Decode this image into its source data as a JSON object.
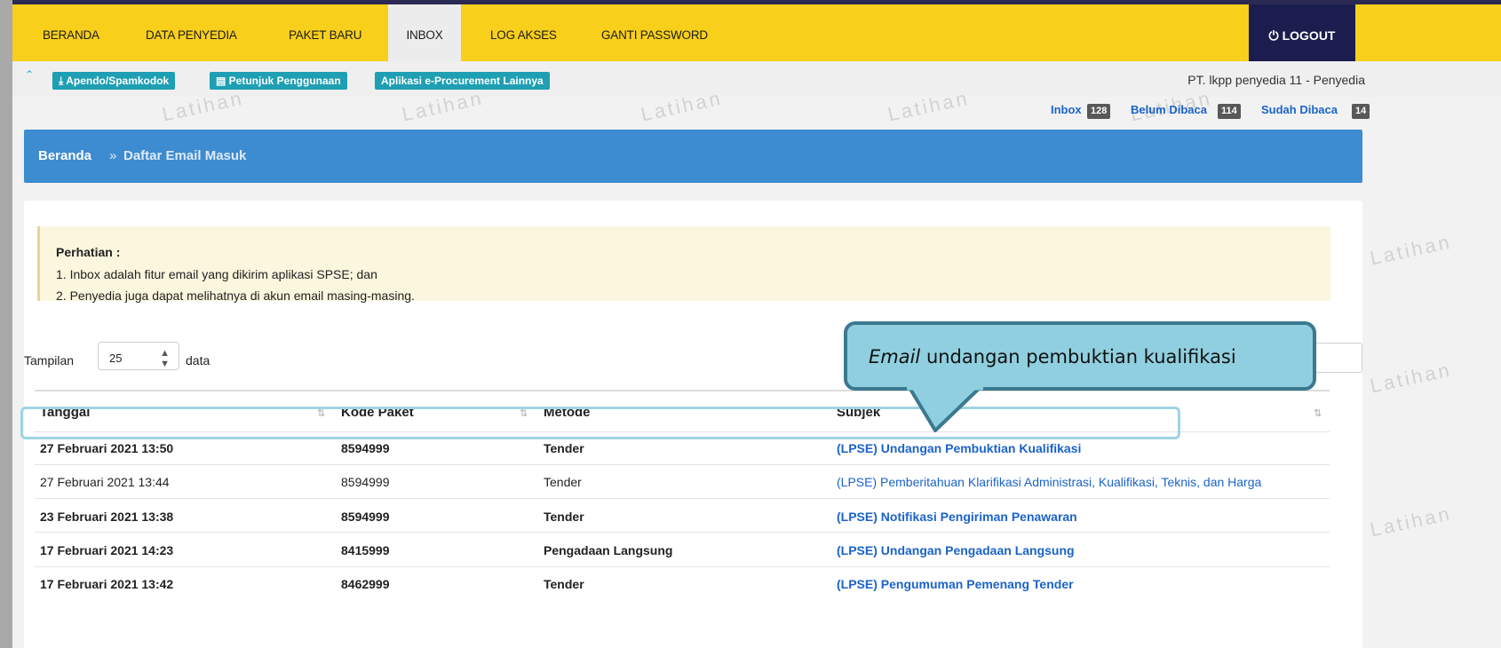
{
  "nav": {
    "items": [
      {
        "label": "BERANDA"
      },
      {
        "label": "DATA PENYEDIA"
      },
      {
        "label": "PAKET BARU"
      },
      {
        "label": "INBOX"
      },
      {
        "label": "LOG AKSES"
      },
      {
        "label": "GANTI PASSWORD"
      }
    ],
    "active_index": 3,
    "logout_label": "LOGOUT",
    "logout_icon": "power-icon"
  },
  "toolbar": {
    "collapse_icon": "double-chevron-up-icon",
    "apendo_label": "Apendo/Spamkodok",
    "petunjuk_label": "Petunjuk Penggunaan",
    "aplikasi_label": "Aplikasi e-Procurement Lainnya",
    "user_label": "PT. lkpp penyedia 11 - Penyedia"
  },
  "watermark": "Latihan",
  "counters": {
    "inbox_label": "Inbox",
    "inbox_count": "128",
    "unread_label": "Belum Dibaca",
    "unread_count": "114",
    "read_label": "Sudah Dibaca",
    "read_count": "14"
  },
  "breadcrumb": {
    "home": "Beranda",
    "separator": "»",
    "current": "Daftar Email Masuk"
  },
  "alert": {
    "title": "Perhatian :",
    "line1": "1. Inbox adalah fitur email yang dikirim aplikasi SPSE; dan",
    "line2": "2. Penyedia juga dapat melihatnya di akun email masing-masing."
  },
  "table_controls": {
    "show_label": "Tampilan",
    "page_length": "25",
    "data_label": "data"
  },
  "table": {
    "columns": [
      "Tanggal",
      "Kode Paket",
      "Metode",
      "Subjek"
    ],
    "rows": [
      {
        "tanggal": "27 Februari 2021 13:50",
        "kode": "8594999",
        "metode": "Tender",
        "subjek": "(LPSE) Undangan Pembuktian Kualifikasi",
        "unread": true
      },
      {
        "tanggal": "27 Februari 2021 13:44",
        "kode": "8594999",
        "metode": "Tender",
        "subjek": "(LPSE) Pemberitahuan Klarifikasi Administrasi, Kualifikasi, Teknis, dan Harga",
        "unread": false
      },
      {
        "tanggal": "23 Februari 2021 13:38",
        "kode": "8594999",
        "metode": "Tender",
        "subjek": "(LPSE) Notifikasi Pengiriman Penawaran",
        "unread": true
      },
      {
        "tanggal": "17 Februari 2021 14:23",
        "kode": "8415999",
        "metode": "Pengadaan Langsung",
        "subjek": "(LPSE) Undangan Pengadaan Langsung",
        "unread": true
      },
      {
        "tanggal": "17 Februari 2021 13:42",
        "kode": "8462999",
        "metode": "Tender",
        "subjek": "(LPSE) Pengumuman Pemenang Tender",
        "unread": true
      }
    ]
  },
  "callout": {
    "italic": "Email",
    "text": " undangan pembuktian kualifikasi"
  },
  "colors": {
    "nav_bg": "#f8cf1b",
    "logout_bg": "#1b1d4e",
    "breadcrumb_bg": "#3d8bd0",
    "tag_bg": "#1e9fb3",
    "link": "#1b63c9",
    "callout_bg": "#8fcfdf",
    "callout_border": "#3b7990"
  }
}
